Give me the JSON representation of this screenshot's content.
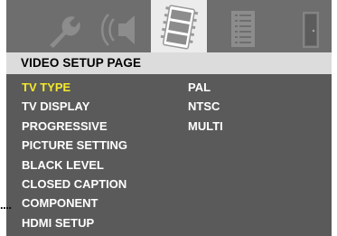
{
  "tabs": [
    {
      "name": "general-setup",
      "icon": "wrench-icon"
    },
    {
      "name": "audio-setup",
      "icon": "speaker-icon"
    },
    {
      "name": "video-setup",
      "icon": "film-icon",
      "selected": true
    },
    {
      "name": "preference-setup",
      "icon": "document-icon"
    },
    {
      "name": "exit",
      "icon": "door-icon"
    }
  ],
  "page": {
    "title": "VIDEO SETUP PAGE"
  },
  "menu": {
    "items": [
      {
        "label": "TV TYPE",
        "active": true
      },
      {
        "label": "TV DISPLAY"
      },
      {
        "label": "PROGRESSIVE"
      },
      {
        "label": "PICTURE SETTING"
      },
      {
        "label": "BLACK LEVEL"
      },
      {
        "label": "CLOSED CAPTION"
      },
      {
        "label": "COMPONENT"
      },
      {
        "label": "HDMI SETUP"
      }
    ]
  },
  "submenu": {
    "options": [
      {
        "label": "PAL"
      },
      {
        "label": "NTSC"
      },
      {
        "label": "MULTI"
      }
    ]
  },
  "callout": {
    "leader": "...."
  },
  "colors": {
    "panel": "#5a5a5a",
    "tab_bar": "#6e6e6e",
    "header_bar": "#dcdcdc",
    "active_item": "#f4e92a",
    "text": "#ffffff",
    "icon": "#8c8c8c"
  }
}
